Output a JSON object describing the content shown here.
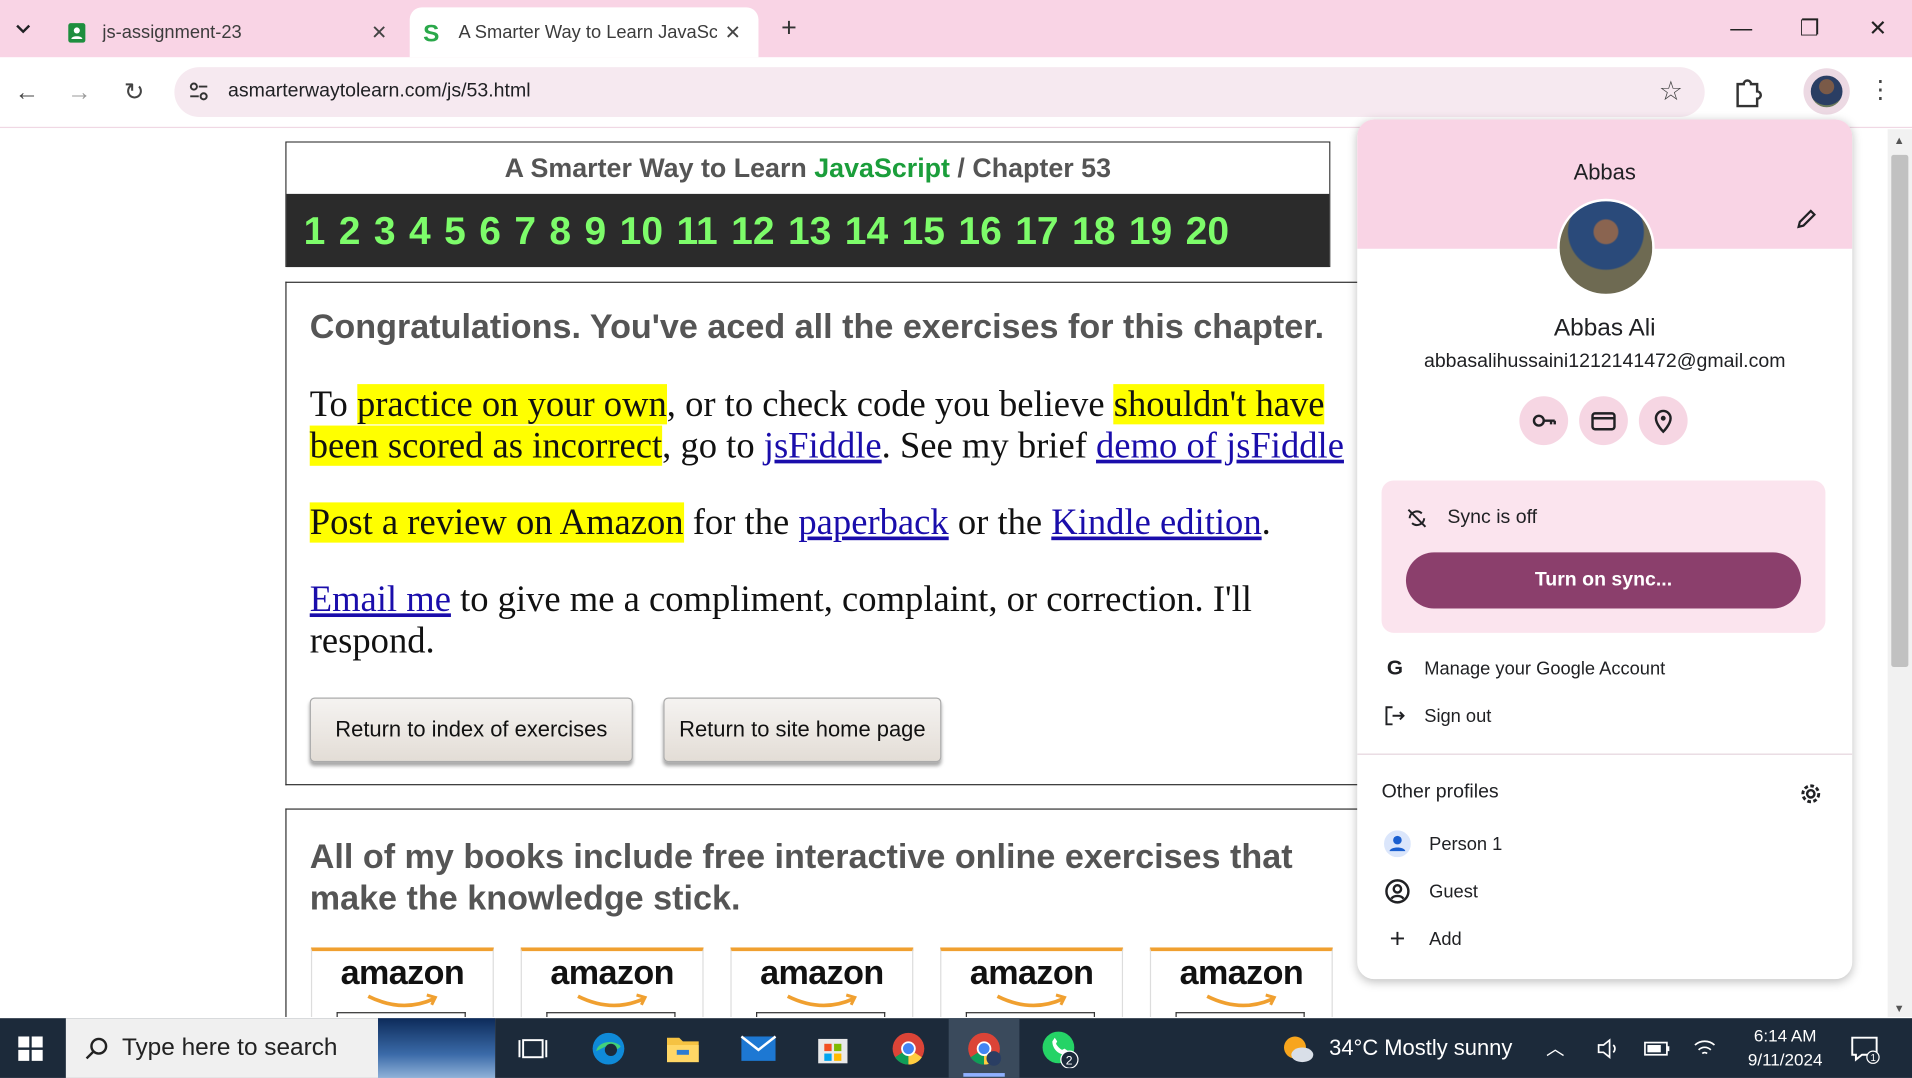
{
  "browser": {
    "tabs": [
      {
        "title": "js-assignment-23",
        "icon": "sheets-icon"
      },
      {
        "title": "A Smarter Way to Learn JavaScr",
        "icon": "site-s-icon",
        "active": true
      }
    ],
    "url": "asmarterwaytolearn.com/js/53.html"
  },
  "page": {
    "header_prefix": "A Smarter Way to Learn ",
    "header_js": "JavaScript",
    "header_suffix": " / Chapter 53",
    "chapters": [
      "1",
      "2",
      "3",
      "4",
      "5",
      "6",
      "7",
      "8",
      "9",
      "10",
      "11",
      "12",
      "13",
      "14",
      "15",
      "16",
      "17",
      "18",
      "19",
      "20"
    ],
    "congrats": "Congratulations. You've aced all the exercises for this chapter.",
    "p1": {
      "t1": "To ",
      "h1": "practice on your own",
      "t2": ", or to check code you believe ",
      "h2": "shouldn't have been scored as incorrect",
      "t3": ", go to ",
      "link1": "jsFiddle",
      "t4": ". See my brief ",
      "link2": "demo of jsFiddle"
    },
    "p2": {
      "h1": "Post a review on Amazon",
      "t1": " for the ",
      "link1": "paperback",
      "t2": " or the ",
      "link2": "Kindle edition",
      "t3": "."
    },
    "p3": {
      "link1": "Email me",
      "t1": " to give me a compliment, complaint, or correction. I'll respond."
    },
    "btn_index": "Return to index of exercises",
    "btn_home": "Return to site home page",
    "books_head": "All of my books include free interactive online exercises that make the knowledge stick.",
    "amazon": [
      "amazon",
      "amazon",
      "amazon",
      "amazon",
      "amazon"
    ]
  },
  "profile": {
    "short_name": "Abbas",
    "full_name": "Abbas Ali",
    "email": "abbasalihussaini1212141472@gmail.com",
    "sync_status": "Sync is off",
    "sync_button": "Turn on sync...",
    "manage": "Manage your Google Account",
    "signout": "Sign out",
    "other_profiles": "Other profiles",
    "person1": "Person 1",
    "guest": "Guest",
    "add": "Add",
    "accent": "#8b3f6c"
  },
  "taskbar": {
    "search_placeholder": "Type here to search",
    "whatsapp_badge": "2",
    "weather": "34°C  Mostly sunny",
    "time": "6:14 AM",
    "date": "9/11/2024",
    "notif_count": "1"
  }
}
